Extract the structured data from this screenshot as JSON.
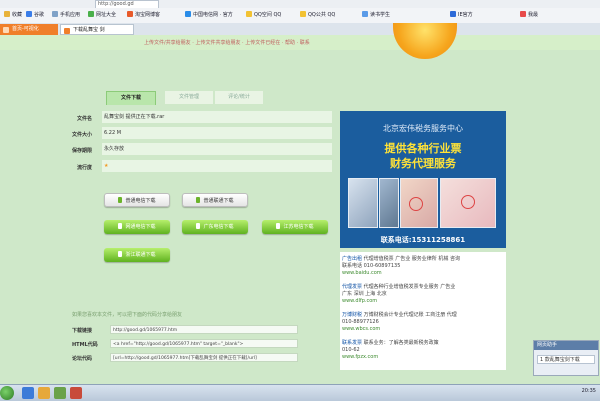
{
  "browser": {
    "url": "http://good.gd",
    "favorites": [
      {
        "label": "收藏",
        "color": "#e8b23a"
      },
      {
        "label": "谷歌",
        "color": "#3a7de8"
      },
      {
        "label": "手机应用",
        "color": "#7fa2c7"
      },
      {
        "label": "网址大全",
        "color": "#4bb04b"
      },
      {
        "label": "淘宝网博客",
        "color": "#e85a2a"
      },
      {
        "label": "中国电信网 · 官方",
        "color": "#2a8ce8"
      },
      {
        "label": "QQ空间 QQ",
        "color": "#f2c233"
      },
      {
        "label": "QQ公共 QQ",
        "color": "#f2c233"
      },
      {
        "label": "读书学生",
        "color": "#5a9be8"
      },
      {
        "label": "IE官方",
        "color": "#2d6ad8"
      },
      {
        "label": "我最",
        "color": "#e84a4a"
      }
    ],
    "tabs": [
      {
        "label": "首页-可视化",
        "icon_color": "#fff6"
      },
      {
        "label": "下载乱舞宝 剑",
        "icon_color": "#f07f2a"
      }
    ]
  },
  "header": {
    "notice": "上传文件/共享给朋友 · 上传文件共享给朋友 · 上传文件已经在 · 帮助 · 联系"
  },
  "page_tabs": [
    "文件下载",
    "文件管理",
    "评论/统计"
  ],
  "file_info": {
    "rows": [
      {
        "label": "文件名",
        "value": "乱舞宝剑 提供正在下载.rar"
      },
      {
        "label": "文件大小",
        "value": "6.22 M"
      },
      {
        "label": "保存期限",
        "value": "永久存放"
      },
      {
        "label": "流行度",
        "value": "★"
      }
    ]
  },
  "download_buttons": {
    "row1": [
      "普通电信下载",
      "普通联通下载"
    ],
    "row2": [
      "网通电信下载",
      "广东电信下载",
      "江苏电信下载"
    ],
    "row3": [
      "浙江联通下载"
    ]
  },
  "share": {
    "note": "如果您喜欢本文件，可以把下面的代码分享给朋友",
    "rows": [
      {
        "label": "下载链接",
        "value": "http://good.gd/1065977.htm"
      },
      {
        "label": "HTML代码",
        "value": "<a href=\"http://good.gd/1065977.htm\" target=\"_blank\">"
      },
      {
        "label": "论坛代码",
        "value": "[url=http://good.gd/1065977.htm]下载乱舞宝剑 提供正在下载[/url]"
      }
    ]
  },
  "ad": {
    "title": "北京宏伟税务服务中心",
    "line1": "提供各种行业票",
    "line2": "财务代理服务",
    "phone": "联系电话:15311258861"
  },
  "links": [
    {
      "title": "广告出租",
      "desc": "代理增值税票 广告业 服务业律所 机械 咨询",
      "url": "www.baidu.com",
      "extra": "联系电话 010-60897135"
    },
    {
      "title": "代理发票",
      "desc": "代理各种行业增值税发票专业服务 广告业",
      "url": "www.dlfp.com",
      "extra": "广东 深圳 上海 北京"
    },
    {
      "title": "万博财税",
      "desc": "万博财税会计专业代理记账 工商注册 代理",
      "url": "www.wbcs.com",
      "extra": "010-88977126"
    },
    {
      "title": "联系发票",
      "desc": "联系业务：了解各类最新税务政策",
      "url": "www.fpzx.com",
      "extra": "010-62"
    }
  ],
  "popup": {
    "title": "网页助手",
    "item": "1 款乱舞宝剑下载"
  },
  "taskbar": {
    "clock": "20:35"
  }
}
